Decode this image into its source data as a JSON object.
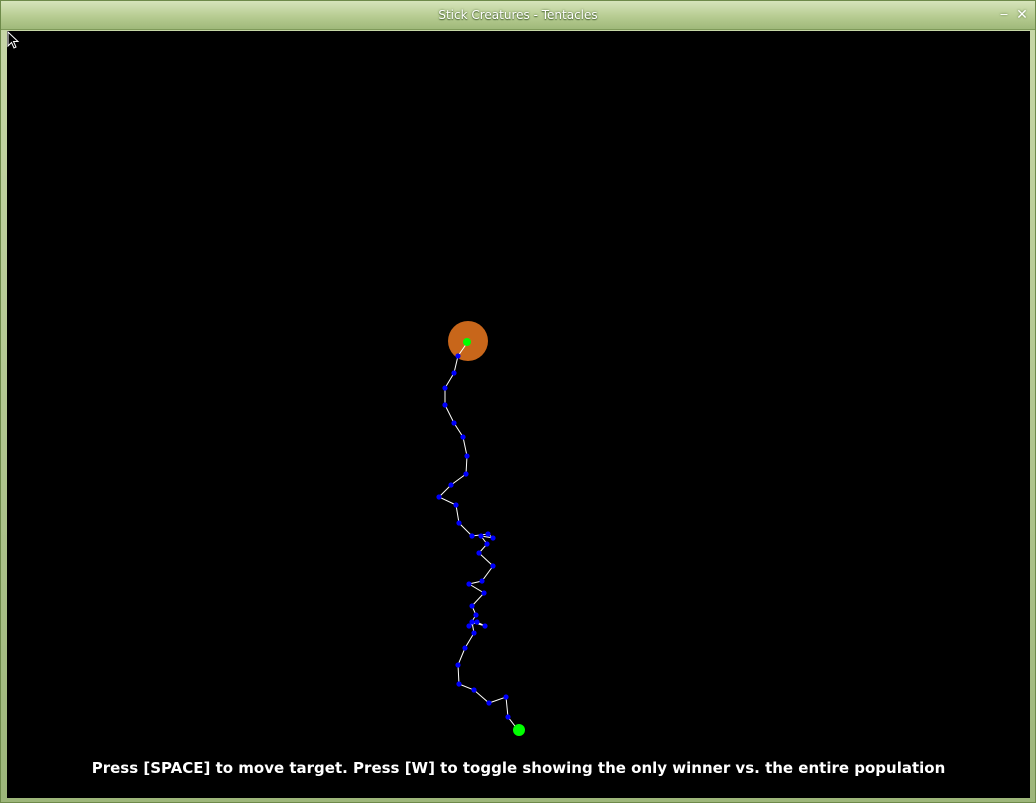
{
  "window": {
    "title": "Stick Creatures - Tentacles",
    "minimize_glyph": "‒",
    "close_glyph": "✕"
  },
  "scene": {
    "background_color": "#000000",
    "target_color": "#c8661a",
    "joint_color": "#0000ff",
    "segment_color": "#ffffff",
    "endpoint_color": "#00ff00",
    "hint_text": "Press [SPACE] to move target.  Press [W] to toggle showing the only winner vs. the entire population"
  }
}
